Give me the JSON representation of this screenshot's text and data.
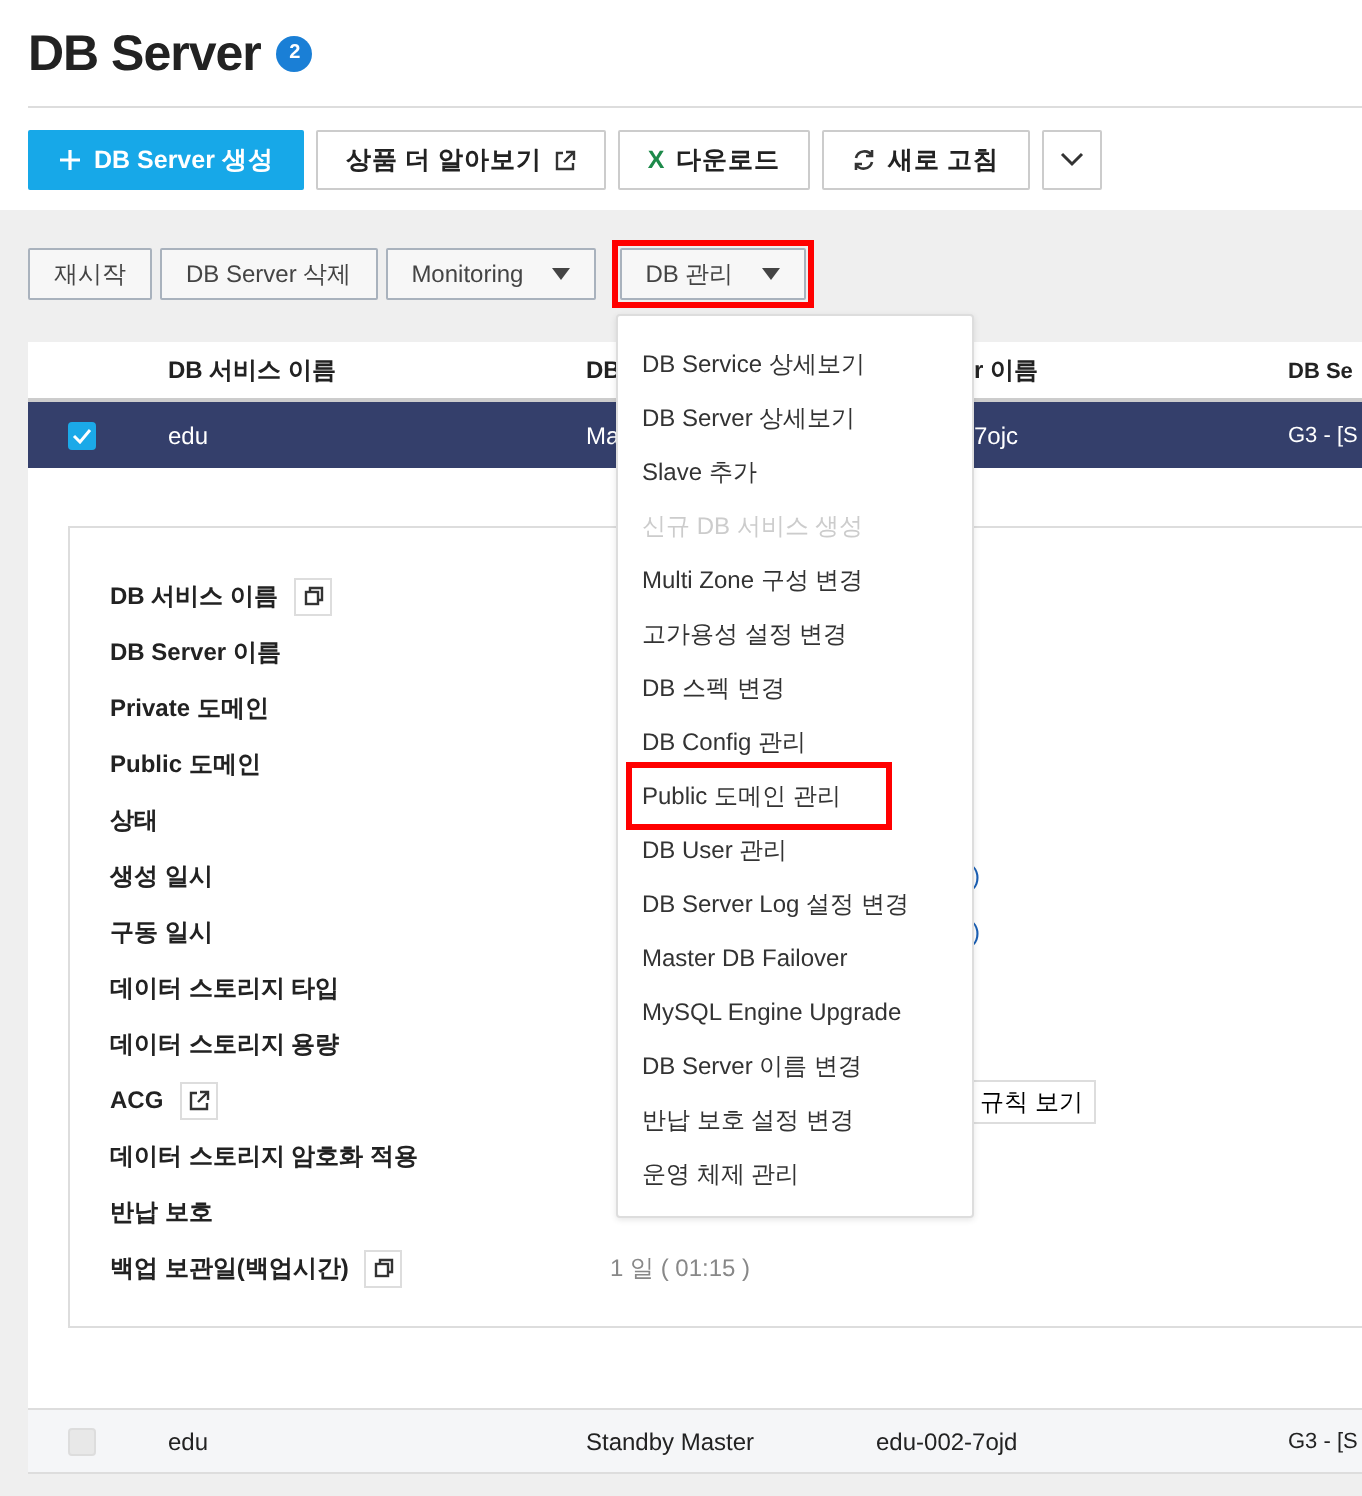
{
  "page": {
    "title": "DB Server",
    "badge": "2"
  },
  "toolbar": [
    {
      "kind": "primary",
      "label": "DB Server 생성"
    },
    {
      "kind": "default",
      "label": "상품 더 알아보기"
    },
    {
      "kind": "default",
      "icon_text": "X",
      "label": "다운로드"
    },
    {
      "kind": "default",
      "label": "새로 고침"
    },
    {
      "kind": "default"
    }
  ],
  "actions": [
    {
      "label": "재시작",
      "dropdown": false,
      "highlighted": false
    },
    {
      "label": "DB Server 삭제",
      "dropdown": false,
      "highlighted": false
    },
    {
      "label": "Monitoring",
      "dropdown": true,
      "highlighted": false
    },
    {
      "label": "DB 관리",
      "dropdown": true,
      "highlighted": true
    }
  ],
  "table": {
    "columns": [
      "DB 서비스 이름",
      "DB",
      "r 이름",
      "DB Se"
    ],
    "rows": [
      {
        "selected": true,
        "cells": [
          "edu",
          "Ma",
          "7ojc",
          "G3 - [S"
        ],
        "details": [
          {
            "label": "DB 서비스 이름",
            "kind": "copy"
          },
          {
            "label": "DB Server 이름"
          },
          {
            "label": "Private 도메인"
          },
          {
            "label": "Public 도메인"
          },
          {
            "label": "상태"
          },
          {
            "label": "생성 일시",
            "value": ")"
          },
          {
            "label": "구동 일시",
            "value": ")"
          },
          {
            "label": "데이터 스토리지 타입"
          },
          {
            "label": "데이터 스토리지 용량"
          },
          {
            "label": "ACG",
            "kind": "link",
            "button": "규칙 보기"
          },
          {
            "label": "데이터 스토리지 암호화 적용"
          },
          {
            "label": "반납 보호"
          },
          {
            "label": "백업 보관일(백업시간)",
            "kind": "copy",
            "value": "1 일 ( 01:15 )"
          }
        ]
      },
      {
        "selected": false,
        "cells": [
          "edu",
          "Standby Master",
          "edu-002-7ojd",
          "G3 - [S"
        ]
      }
    ]
  },
  "menu": {
    "items": [
      {
        "label": "DB Service 상세보기",
        "disabled": false,
        "highlighted": false
      },
      {
        "label": "DB Server 상세보기",
        "disabled": false,
        "highlighted": false
      },
      {
        "label": "Slave 추가",
        "disabled": false,
        "highlighted": false
      },
      {
        "label": "신규 DB 서비스 생성",
        "disabled": true,
        "highlighted": false
      },
      {
        "label": "Multi Zone 구성 변경",
        "disabled": false,
        "highlighted": false
      },
      {
        "label": "고가용성 설정 변경",
        "disabled": false,
        "highlighted": false
      },
      {
        "label": "DB 스펙 변경",
        "disabled": false,
        "highlighted": false
      },
      {
        "label": "DB Config 관리",
        "disabled": false,
        "highlighted": false
      },
      {
        "label": "Public 도메인 관리",
        "disabled": false,
        "highlighted": true
      },
      {
        "label": "DB User 관리",
        "disabled": false,
        "highlighted": false
      },
      {
        "label": "DB Server Log 설정 변경",
        "disabled": false,
        "highlighted": false
      },
      {
        "label": "Master DB Failover",
        "disabled": false,
        "highlighted": false
      },
      {
        "label": "MySQL Engine Upgrade",
        "disabled": false,
        "highlighted": false
      },
      {
        "label": "DB Server 이름 변경",
        "disabled": false,
        "highlighted": false
      },
      {
        "label": "반납 보호 설정 변경",
        "disabled": false,
        "highlighted": false
      },
      {
        "label": "운영 체제 관리",
        "disabled": false,
        "highlighted": false
      }
    ]
  }
}
